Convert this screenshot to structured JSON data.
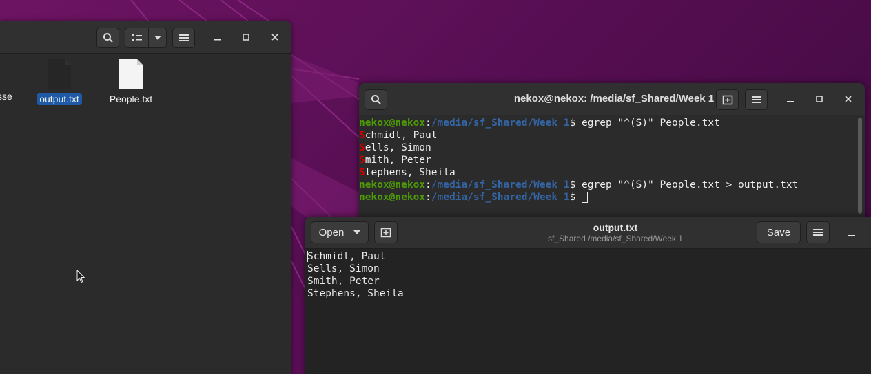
{
  "file_manager": {
    "files": [
      {
        "name": "sse",
        "icon": "document-icon"
      },
      {
        "name": "output.txt",
        "icon": "document-icon",
        "selected": true
      },
      {
        "name": "People.txt",
        "icon": "text-file-icon"
      }
    ]
  },
  "terminal": {
    "title": "nekox@nekox: /media/sf_Shared/Week 1",
    "prompt_user": "nekox@nekox",
    "prompt_path": "/media/sf_Shared/Week 1",
    "commands": [
      "egrep \"^(S)\" People.txt",
      "egrep \"^(S)\" People.txt > output.txt",
      ""
    ],
    "output": [
      {
        "first": "S",
        "rest": "chmidt, Paul"
      },
      {
        "first": "S",
        "rest": "ells, Simon"
      },
      {
        "first": "S",
        "rest": "mith, Peter"
      },
      {
        "first": "S",
        "rest": "tephens, Sheila"
      }
    ]
  },
  "editor": {
    "title": "output.txt",
    "subtitle": "sf_Shared /media/sf_Shared/Week 1",
    "open_label": "Open",
    "save_label": "Save",
    "lines": [
      "Schmidt, Paul",
      "Sells, Simon",
      "Smith, Peter",
      "Stephens, Sheila"
    ]
  },
  "colors": {
    "prompt_user": "#4e9a06",
    "prompt_path": "#3465a4",
    "match": "#cc0000",
    "selection": "#1e5aa5"
  }
}
